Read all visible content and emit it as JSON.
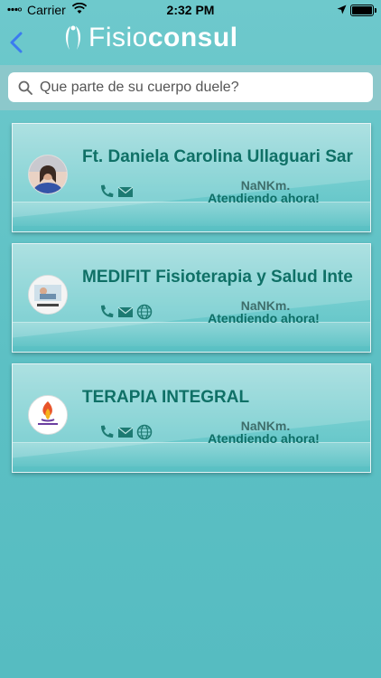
{
  "status_bar": {
    "carrier": "Carrier",
    "time": "2:32 PM"
  },
  "nav": {
    "logo_regular": "Fisio",
    "logo_bold": "consul"
  },
  "search": {
    "placeholder": "Que parte de su cuerpo duele?"
  },
  "colors": {
    "accent": "#0f7066",
    "background": "#5cc0c4",
    "search_band": "#8cc8cb"
  },
  "results": [
    {
      "name": "Ft. Daniela Carolina Ullaguari Sar",
      "distance": "NaNKm.",
      "status": "Atendiendo ahora!",
      "icons": [
        "phone-icon",
        "mail-icon"
      ]
    },
    {
      "name": "MEDIFIT Fisioterapia y Salud Inte",
      "distance": "NaNKm.",
      "status": "Atendiendo ahora!",
      "icons": [
        "phone-icon",
        "mail-icon",
        "globe-icon"
      ]
    },
    {
      "name": "TERAPIA INTEGRAL",
      "distance": "NaNKm.",
      "status": "Atendiendo ahora!",
      "icons": [
        "phone-icon",
        "mail-icon",
        "globe-icon"
      ]
    }
  ]
}
